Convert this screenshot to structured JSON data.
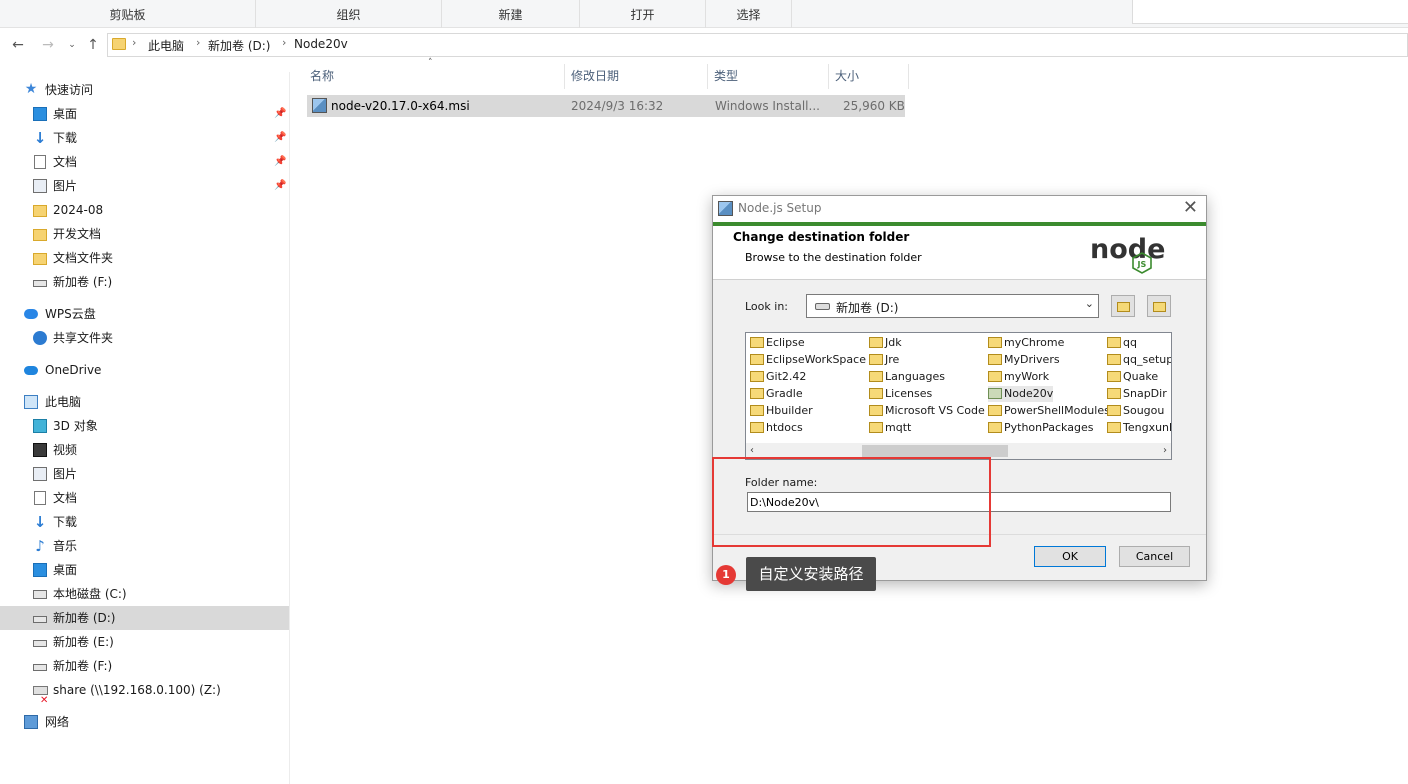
{
  "ribbon": {
    "groups": [
      "剪贴板",
      "组织",
      "新建",
      "打开",
      "选择"
    ]
  },
  "address": {
    "crumbs": [
      "此电脑",
      "新加卷 (D:)",
      "Node20v"
    ]
  },
  "nav": {
    "quick_access": "快速访问",
    "pinned": [
      "桌面",
      "下载",
      "文档",
      "图片"
    ],
    "recent_folders": [
      "2024-08",
      "开发文档",
      "文档文件夹",
      "新加卷 (F:)"
    ],
    "wps": "WPS云盘",
    "shared": "共享文件夹",
    "onedrive": "OneDrive",
    "this_pc": "此电脑",
    "pc_items": [
      "3D 对象",
      "视频",
      "图片",
      "文档",
      "下载",
      "音乐",
      "桌面",
      "本地磁盘 (C:)",
      "新加卷 (D:)",
      "新加卷 (E:)",
      "新加卷 (F:)",
      "share (\\\\192.168.0.100) (Z:)"
    ],
    "network": "网络"
  },
  "filelist": {
    "columns": [
      "名称",
      "修改日期",
      "类型",
      "大小"
    ],
    "rows": [
      {
        "name": "node-v20.17.0-x64.msi",
        "date": "2024/9/3 16:32",
        "type": "Windows Install...",
        "size": "25,960 KB"
      }
    ]
  },
  "dialog": {
    "title": "Node.js Setup",
    "heading": "Change destination folder",
    "subheading": "Browse to the destination folder",
    "logo_text": "node",
    "logo_sub": "JS",
    "look_in_label": "Look in:",
    "look_in_value": "新加卷 (D:)",
    "folders": [
      [
        "Eclipse",
        "EclipseWorkSpace",
        "Git2.42",
        "Gradle",
        "Hbuilder",
        "htdocs"
      ],
      [
        "Jdk",
        "Jre",
        "Languages",
        "Licenses",
        "Microsoft VS Code",
        "mqtt"
      ],
      [
        "myChrome",
        "MyDrivers",
        "myWork",
        "Node20v",
        "PowerShellModules",
        "PythonPackages"
      ],
      [
        "qq",
        "qq_setup",
        "Quake",
        "SnapDir",
        "Sougou",
        "Tengxunhu"
      ]
    ],
    "folder_name_label": "Folder name:",
    "folder_name_value": "D:\\Node20v\\",
    "ok_label": "OK",
    "cancel_label": "Cancel"
  },
  "annotation": {
    "badge": "1",
    "text": "自定义安装路径",
    "color": "#e53935"
  },
  "colors": {
    "node_green": "#3b8b2e",
    "selection": "#d9d9d9"
  }
}
